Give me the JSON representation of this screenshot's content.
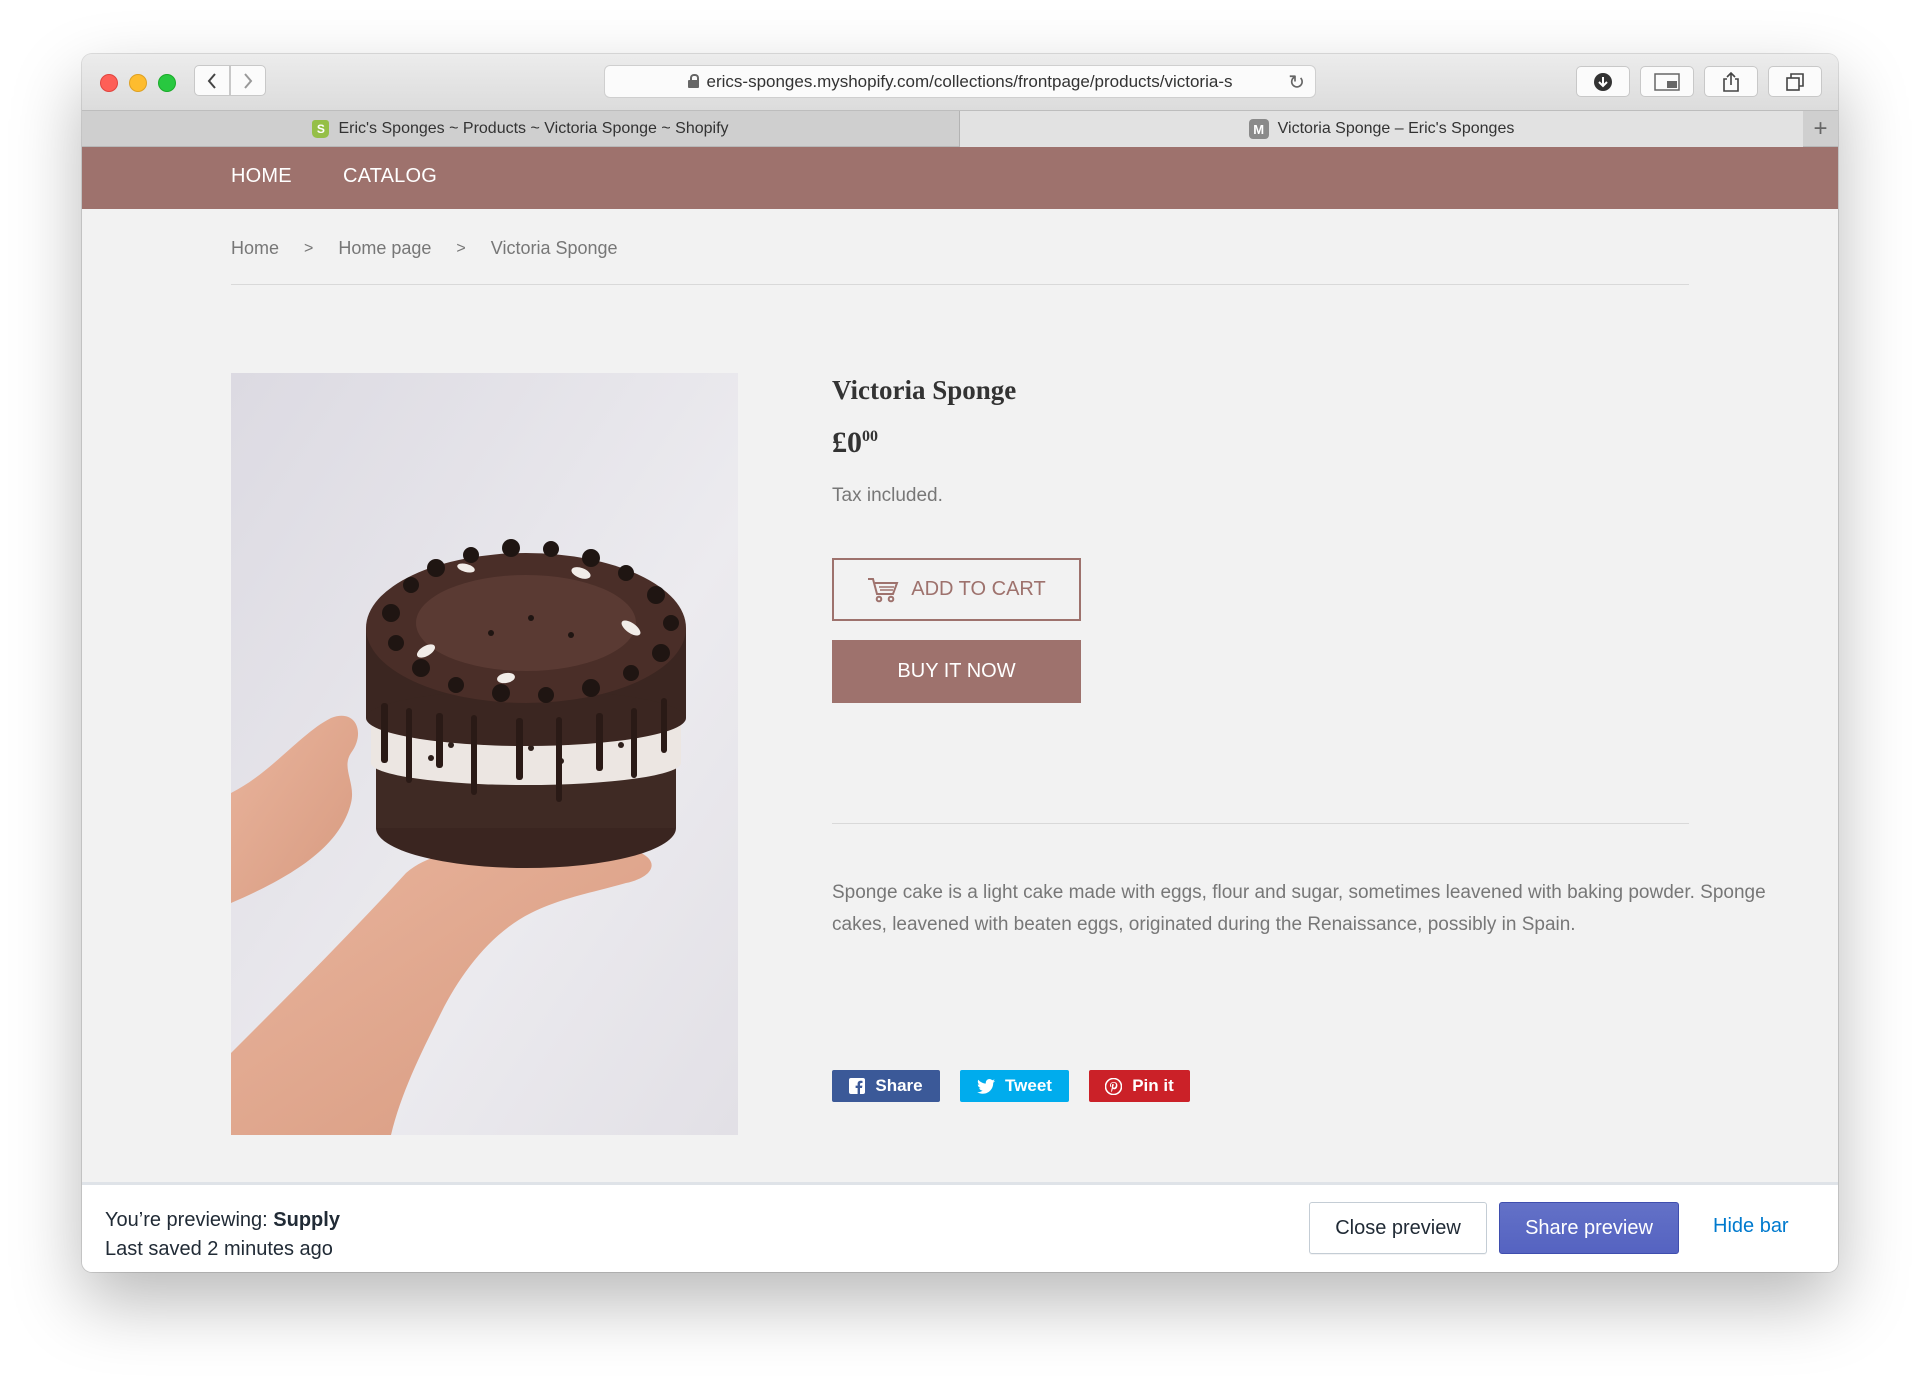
{
  "browser": {
    "url": "erics-sponges.myshopify.com/collections/frontpage/products/victoria-s",
    "tabs": [
      {
        "label": "Eric's Sponges ~ Products ~ Victoria Sponge ~ Shopify",
        "icon": "shopify-icon"
      },
      {
        "label": "Victoria Sponge – Eric's Sponges",
        "icon": "m-favicon-icon"
      }
    ]
  },
  "store": {
    "nav": [
      "HOME",
      "CATALOG"
    ],
    "accent_color": "#9e726d"
  },
  "breadcrumb": [
    "Home",
    "Home page",
    "Victoria Sponge"
  ],
  "breadcrumb_separator": ">",
  "product": {
    "title": "Victoria Sponge",
    "price_main": "£0",
    "price_cents": "00",
    "tax_note": "Tax included.",
    "add_to_cart_label": "ADD TO CART",
    "buy_now_label": "BUY IT NOW",
    "description": "Sponge cake is a light cake made with eggs, flour and sugar, sometimes leavened with baking powder. Sponge cakes, leavened with beaten eggs, originated during the Renaissance, possibly in Spain."
  },
  "social": {
    "facebook": "Share",
    "twitter": "Tweet",
    "pinterest": "Pin it"
  },
  "preview_bar": {
    "previewing_label": "You’re previewing:",
    "theme_name": "Supply",
    "last_saved": "Last saved 2 minutes ago",
    "close_label": "Close preview",
    "share_label": "Share preview",
    "hide_label": "Hide bar"
  }
}
